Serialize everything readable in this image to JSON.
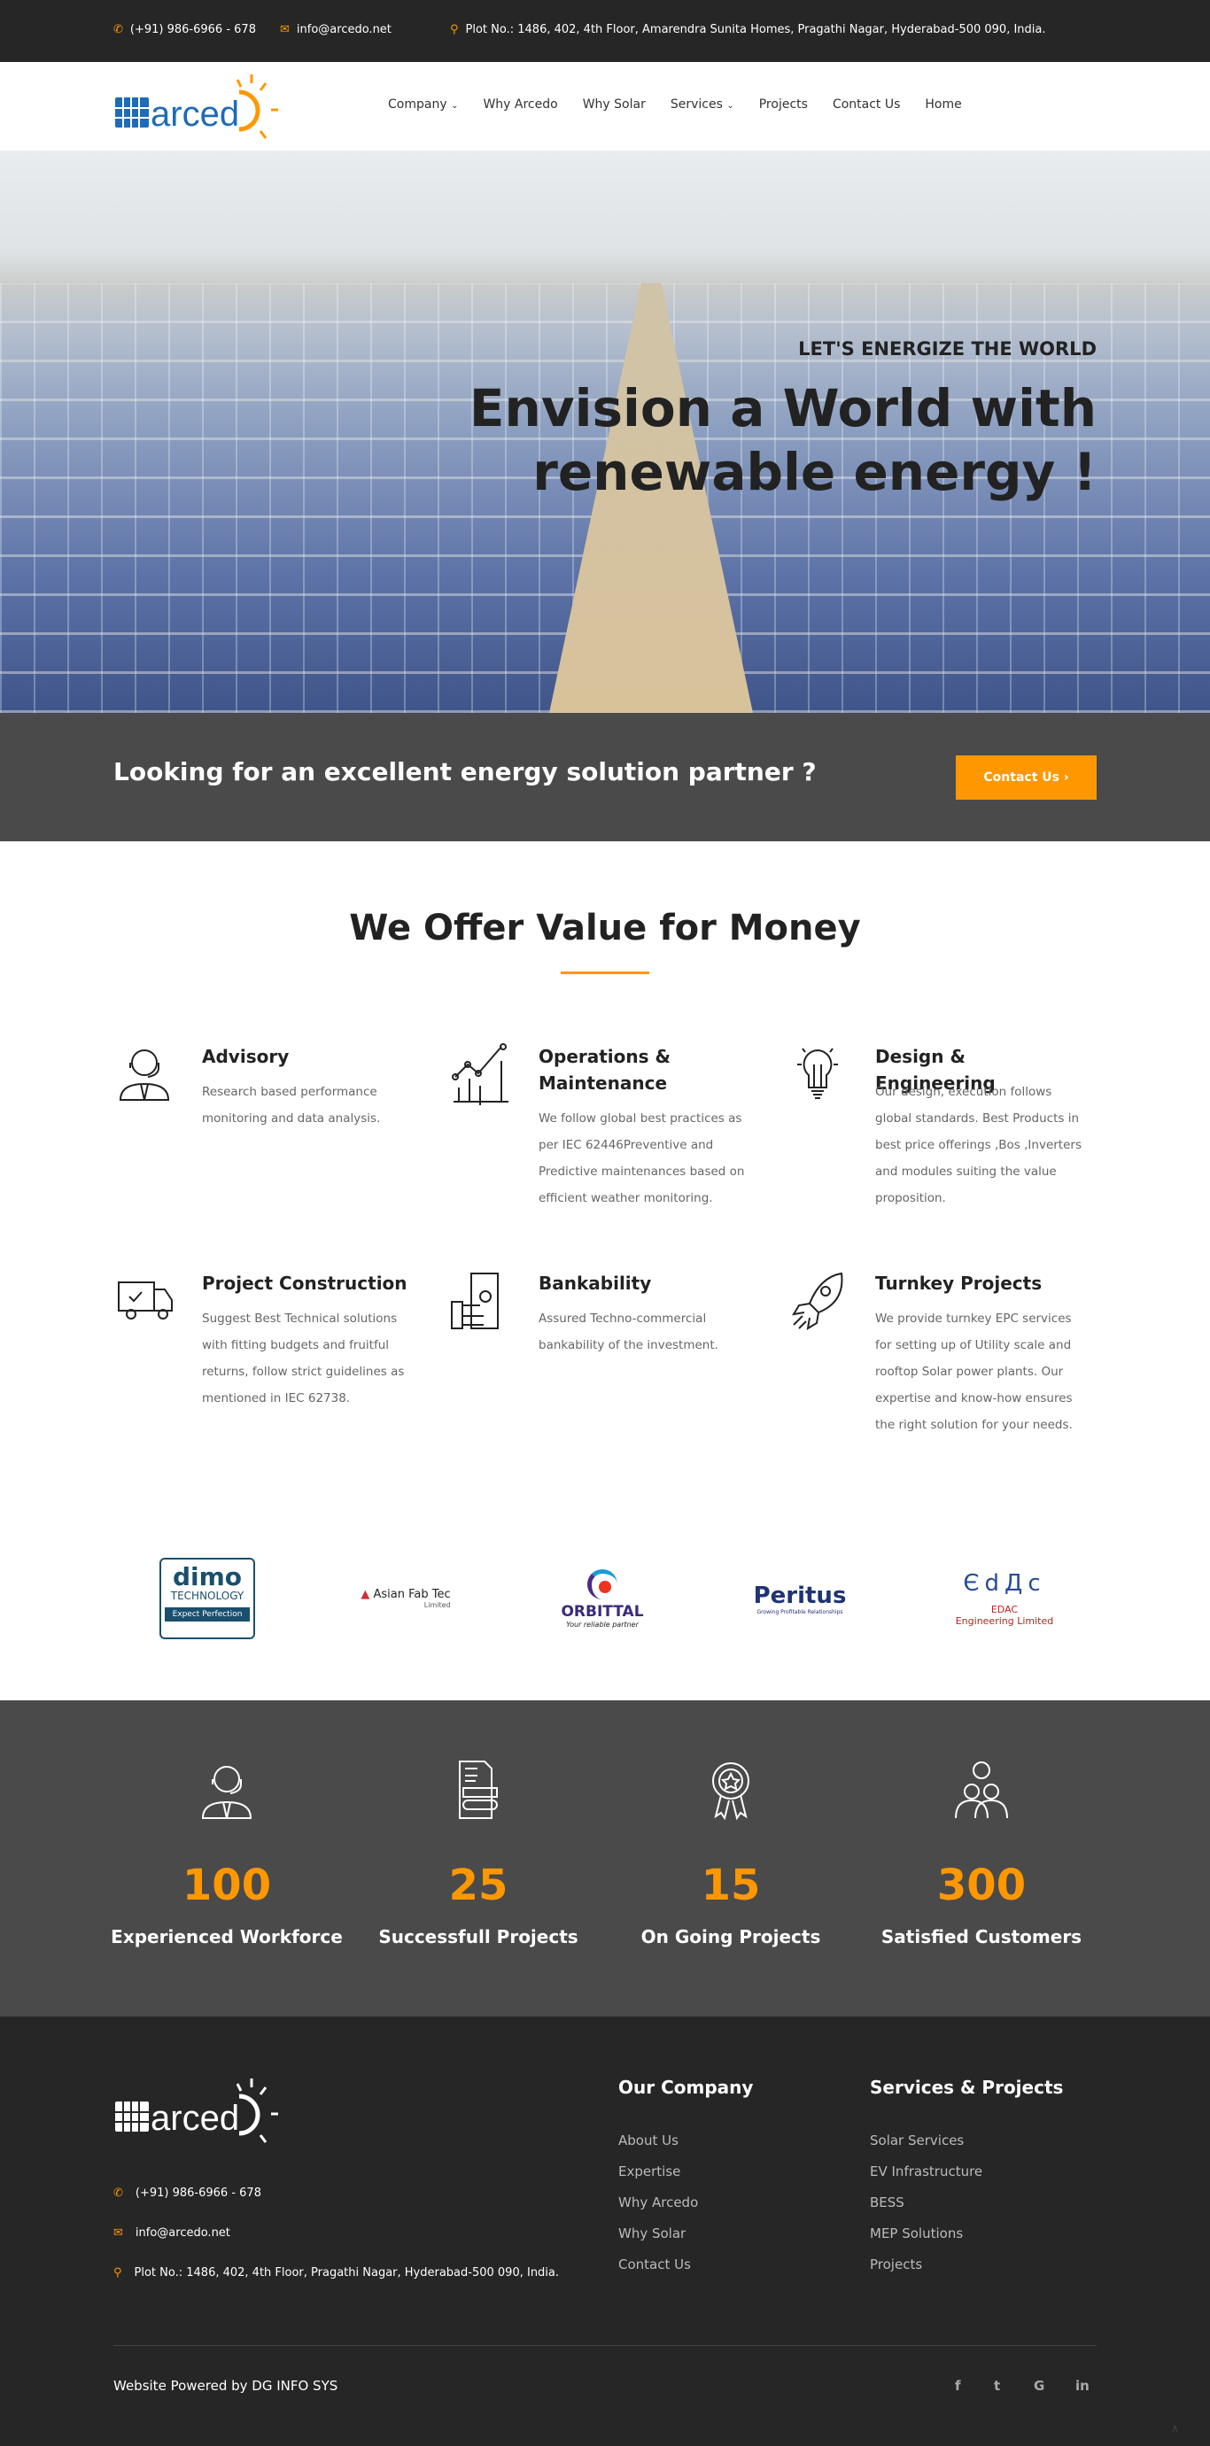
{
  "topbar": {
    "phone": "(+91) 986-6966 - 678",
    "email": "info@arcedo.net",
    "address": "Plot No.: 1486, 402, 4th Floor, Amarendra Sunita Homes, Pragathi Nagar, Hyderabad-500 090, India."
  },
  "brand": {
    "name": "arced",
    "accent": "#ff9800",
    "blue": "#1e6bb8"
  },
  "nav": {
    "items": [
      "Company",
      "Why Arcedo",
      "Why Solar",
      "Services",
      "Projects",
      "Contact Us",
      "Home"
    ]
  },
  "hero": {
    "tagline": "LET'S ENERGIZE THE WORLD",
    "heading": "Envision a World with renewable energy !"
  },
  "cta": {
    "text": "Looking for an excellent energy solution partner ?",
    "button": "Contact Us ›"
  },
  "offer": {
    "title": "We Offer Value for Money",
    "services": [
      {
        "title": "Advisory",
        "icon": "headset-agent-icon",
        "desc": "Research based performance monitoring and data analysis."
      },
      {
        "title": "Operations & Maintenance",
        "icon": "chart-growth-icon",
        "desc": "We follow global best practices as per IEC 62446Preventive and Predictive maintenances based on efficient weather monitoring."
      },
      {
        "title": "Design & Engineering",
        "icon": "lightbulb-icon",
        "desc": "Our design, execution follows global standards. Best Products in best price offerings ,Bos ,Inverters and modules suiting the value proposition."
      },
      {
        "title": "Project Construction",
        "icon": "delivery-truck-icon",
        "desc": "Suggest Best Technical solutions with fitting budgets and fruitful returns, follow strict guidelines as mentioned in IEC 62738."
      },
      {
        "title": "Bankability",
        "icon": "money-hand-icon",
        "desc": "Assured Techno-commercial bankability of the investment."
      },
      {
        "title": "Turnkey Projects",
        "icon": "rocket-icon",
        "desc": "We provide turnkey EPC services for setting up of Utility scale and rooftop Solar power plants. Our expertise and know-how ensures the right solution for your needs."
      }
    ]
  },
  "partners": [
    {
      "name": "dimo",
      "line1": "TECHNOLOGY",
      "line2": "Expect Perfection"
    },
    {
      "name": "Asian Fab Tec",
      "line1": "Limited"
    },
    {
      "name": "ORBITTAL",
      "line1": "Your reliable partner"
    },
    {
      "name": "Peritus",
      "line1": "Growing Profitable Relationships"
    },
    {
      "name": "EDAC",
      "line1": "Engineering Limited"
    }
  ],
  "stats": [
    {
      "value": "100",
      "label": "Experienced Workforce"
    },
    {
      "value": "25",
      "label": "Successfull Projects"
    },
    {
      "value": "15",
      "label": "On Going Projects"
    },
    {
      "value": "300",
      "label": "Satisfied Customers"
    }
  ],
  "footer": {
    "phone": "(+91) 986-6966 - 678",
    "email": "info@arcedo.net",
    "address": "Plot No.: 1486, 402, 4th Floor, Pragathi Nagar, Hyderabad-500 090, India.",
    "company_heading": "Our Company",
    "company_links": [
      "About Us",
      "Expertise",
      "Why Arcedo",
      "Why Solar",
      "Contact Us"
    ],
    "services_heading": "Services & Projects",
    "services_links": [
      "Solar Services",
      "EV Infrastructure",
      "BESS",
      "MEP Solutions",
      "Projects"
    ],
    "credit": "Website Powered by DG INFO SYS",
    "social": [
      "f",
      "t",
      "G",
      "in"
    ]
  }
}
